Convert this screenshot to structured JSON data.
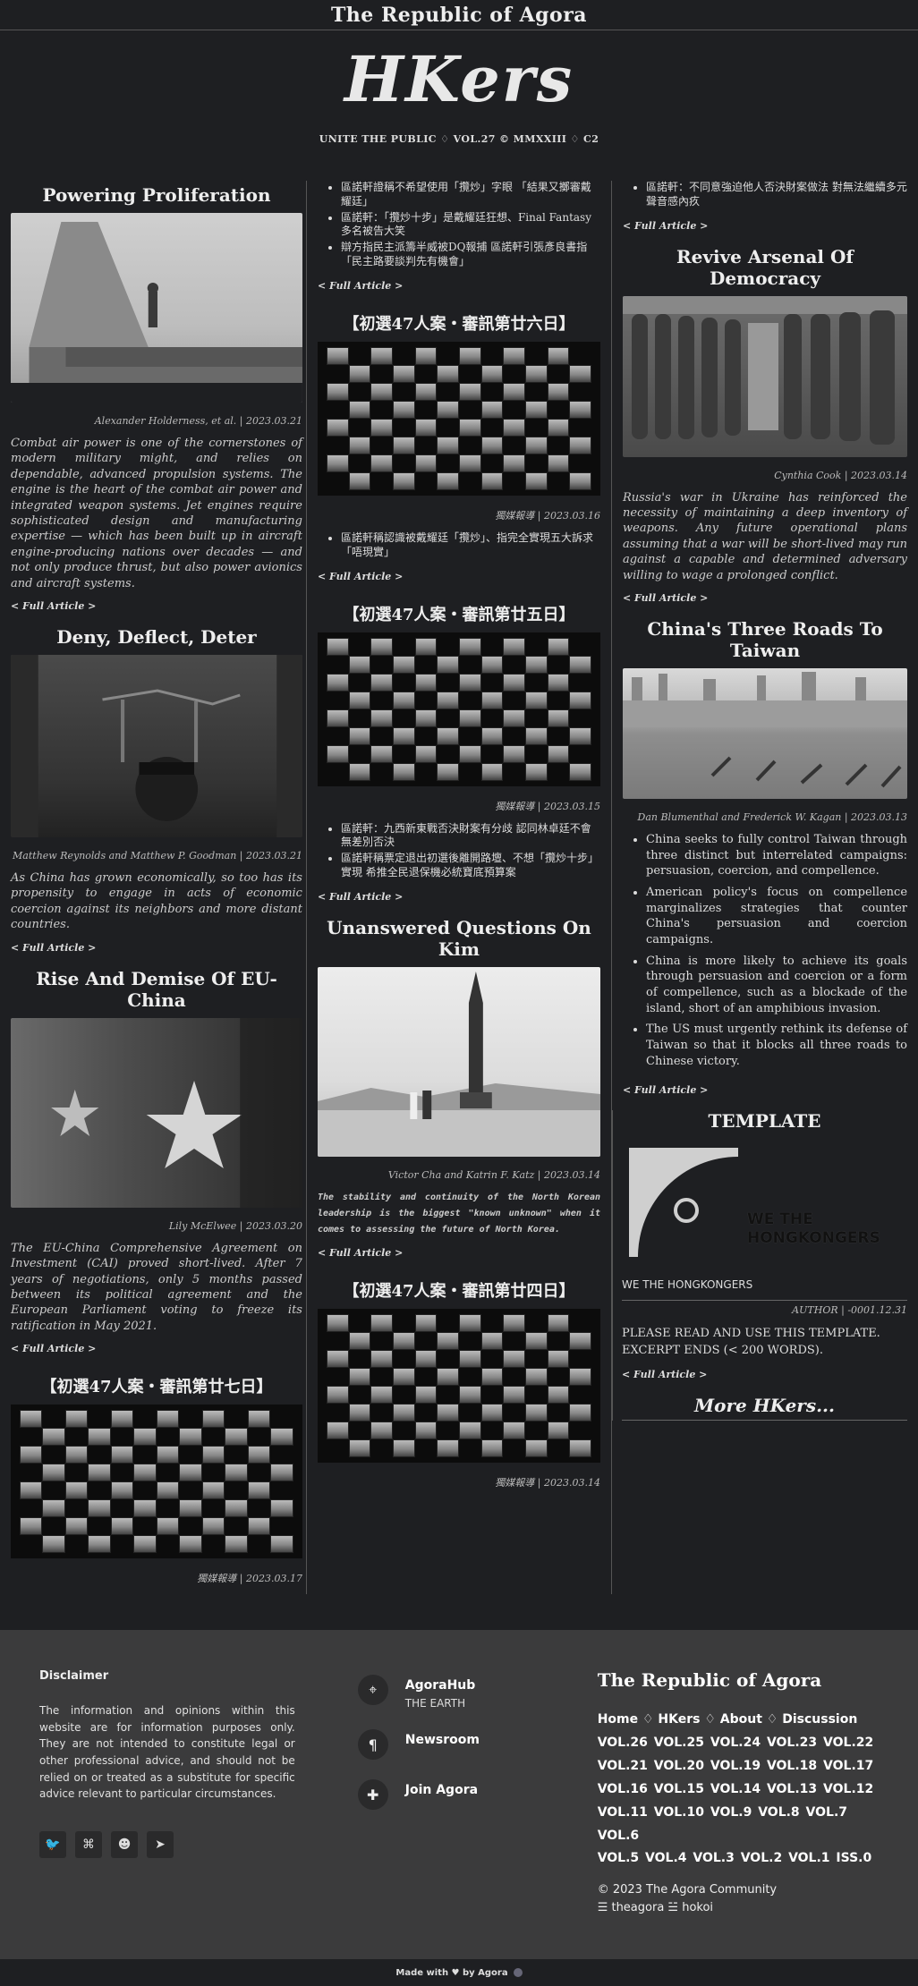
{
  "site": {
    "title": "The Republic of Agora",
    "brand": "HKers",
    "tagline": "UNITE THE PUBLIC ♢ VOL.27 © MMXXIII ♢ C2"
  },
  "left": {
    "a1": {
      "title": "Powering Proliferation",
      "byline": "Alexander Holderness, et al. | 2023.03.21",
      "excerpt": "Combat air power is one of the cornerstones of modern military might, and relies on dependable, advanced propulsion systems. The engine is the heart of the combat air power and integrated weapon systems. Jet engines require sophisticated design and manufacturing expertise — which has been built up in aircraft engine-producing nations over decades — and not only produce thrust, but also power avionics and aircraft systems."
    },
    "a2": {
      "title": "Deny, Deflect, Deter",
      "byline": "Matthew Reynolds and Matthew P. Goodman | 2023.03.21",
      "excerpt": "As China has grown economically, so too has its propensity to engage in acts of economic coercion against its neighbors and more distant countries."
    },
    "a3": {
      "title": "Rise And Demise Of EU-China",
      "byline": "Lily McElwee | 2023.03.20",
      "excerpt": "The EU-China Comprehensive Agreement on Investment (CAI) proved short-lived. After 7 years of negotiations, only 5 months passed between its political agreement and the European Parliament voting to freeze its ratification in May 2021."
    },
    "a4": {
      "title": "【初選47人案・審訊第廿七日】",
      "byline": "獨媒報導 | 2023.03.17"
    }
  },
  "mid": {
    "top_bullets": [
      "區諾軒證稱不希望使用「攬炒」字眼 「結果又擲審戴耀廷」",
      "區諾軒：「攬炒十步」是戴耀廷狂想、Final Fantasy 多名被告大笑",
      "辯方指民主派籌半威被DQ報捕 區諾軒引張彥良書指「民主路要談判先有機會」"
    ],
    "a1": {
      "title": "【初選47人案・審訊第廿六日】",
      "byline": "獨媒報導 | 2023.03.16",
      "bullets": [
        "區諾軒稱認識被戴耀廷「攬炒」、指完全實現五大訴求「唔現實」"
      ]
    },
    "a2": {
      "title": "【初選47人案・審訊第廿五日】",
      "byline": "獨媒報導 | 2023.03.15",
      "bullets": [
        "區諾軒：九西新東戰否決財案有分歧 認同林卓廷不會無差別否決",
        "區諾軒稱票定退出初選後離開路壇、不想「攬炒十步」實現 希推全民退保機必統寶底預算案"
      ]
    },
    "a3": {
      "title": "Unanswered Questions On Kim",
      "byline": "Victor Cha and Katrin F. Katz | 2023.03.14",
      "excerpt": "The stability and continuity of the North Korean leadership is the biggest \"known unknown\" when it comes to assessing the future of North Korea."
    },
    "a4": {
      "title": "【初選47人案・審訊第廿四日】",
      "byline": "獨媒報導 | 2023.03.14"
    }
  },
  "right": {
    "top_bullets": [
      "區諾軒：不同意強迫他人否決財案做法 對無法繼續多元聲音感內疚"
    ],
    "a1": {
      "title": "Revive Arsenal Of Democracy",
      "byline": "Cynthia Cook | 2023.03.14",
      "excerpt": "Russia's war in Ukraine has reinforced the necessity of maintaining a deep inventory of weapons. Any future operational plans assuming that a war will be short-lived may run against a capable and determined adversary willing to wage a prolonged conflict."
    },
    "a2": {
      "title": "China's Three Roads To Taiwan",
      "byline": "Dan Blumenthal and Frederick W. Kagan | 2023.03.13",
      "bullets": [
        "China seeks to fully control Taiwan through three distinct but interrelated campaigns: persuasion, coercion, and compellence.",
        "American policy's focus on compellence marginalizes strategies that counter China's persuasion and coercion campaigns.",
        "China is more likely to achieve its goals through persuasion and coercion or a form of compellence, such as a blockade of the island, short of an amphibious invasion.",
        "The US must urgently rethink its defense of Taiwan so that it blocks all three roads to Chinese victory."
      ]
    },
    "a3": {
      "title": "TEMPLATE",
      "logo_text_1": "WE THE",
      "logo_text_2": "HONGKONGERS",
      "caption": "WE THE HONGKONGERS",
      "byline": "AUTHOR | -0001.12.31",
      "text_1": "PLEASE READ AND USE THIS TEMPLATE.",
      "text_2": "EXCERPT ENDS (< 200 WORDS)."
    },
    "more": "More HKers..."
  },
  "full_article": "< Full Article >",
  "footer": {
    "disclaimer_title": "Disclaimer",
    "disclaimer_text": "The information and opinions within this website are for information purposes only. They are not intended to constitute legal or other professional advice, and should not be relied on or treated as a substitute for specific advice relevant to particular circumstances.",
    "links": [
      {
        "title": "AgoraHub",
        "sub": "THE EARTH"
      },
      {
        "title": "Newsroom",
        "sub": ""
      },
      {
        "title": "Join Agora",
        "sub": ""
      }
    ],
    "title": "The Republic of Agora",
    "nav": [
      "Home",
      "HKers",
      "About",
      "Discussion"
    ],
    "vol_rows": [
      "VOL.26  VOL.25  VOL.24  VOL.23  VOL.22",
      "VOL.21  VOL.20  VOL.19  VOL.18  VOL.17",
      "VOL.16  VOL.15  VOL.14  VOL.13  VOL.12",
      "VOL.11 VOL.10 VOL.9 VOL.8 VOL.7 VOL.6",
      "VOL.5 VOL.4 VOL.3 VOL.2 VOL.1 ISS.0"
    ],
    "copyright": "© 2023 The Agora Community",
    "credits": "☰ theagora ☱ hokoi",
    "made_with": "Made with ♥ by Agora"
  }
}
